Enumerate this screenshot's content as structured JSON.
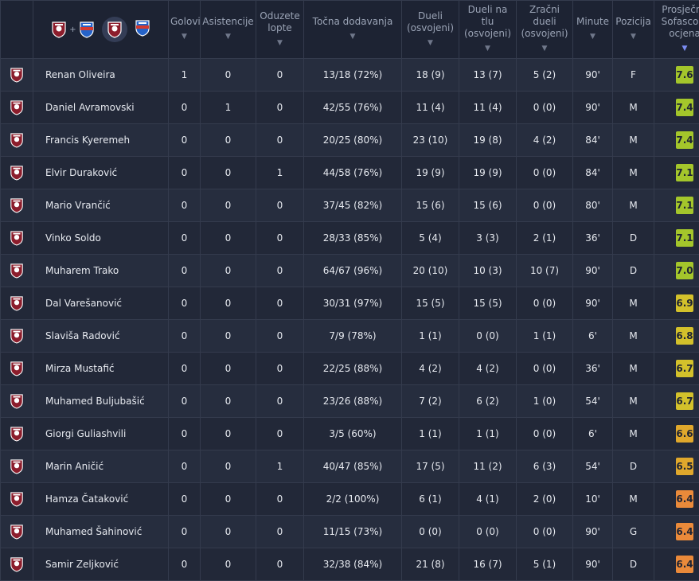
{
  "icons": {
    "team_crest": "club-crest-icon",
    "opponent_crest": "opponent-crest-icon",
    "sort_arrow": "sort-arrow-icon"
  },
  "filter": {
    "plus": "+"
  },
  "columns": [
    {
      "label": "Golovi",
      "arrow": "▼"
    },
    {
      "label": "Asistencije",
      "arrow": "▼"
    },
    {
      "label": "Oduzete lopte",
      "arrow": "▼"
    },
    {
      "label": "Točna dodavanja",
      "arrow": "▼"
    },
    {
      "label": "Dueli (osvojeni)",
      "arrow": "▼"
    },
    {
      "label": "Dueli na tlu (osvojeni)",
      "arrow": "▼"
    },
    {
      "label": "Zračni dueli (osvojeni)",
      "arrow": "▼"
    },
    {
      "label": "Minute",
      "arrow": "▼"
    },
    {
      "label": "Pozicija",
      "arrow": "▼"
    },
    {
      "label": "Prosječna Sofascore ocjena",
      "arrow": "▼"
    }
  ],
  "colors": {
    "rating_high": "#a4c62b",
    "rating_mid_high": "#d3c12b",
    "rating_mid": "#e0a82c",
    "rating_low": "#ea8a3a",
    "crest_red": "#8c1d2c",
    "opponent_blue": "#2563c9",
    "opponent_red": "#d43a30"
  },
  "players": [
    {
      "name": "Renan Oliveira",
      "goals": "1",
      "assists": "0",
      "tackles": "0",
      "passes": "13/18 (72%)",
      "duels": "18 (9)",
      "ground": "13 (7)",
      "aerial": "5 (2)",
      "minutes": "90'",
      "pos": "F",
      "rating": "7.6",
      "tier": "high"
    },
    {
      "name": "Daniel Avramovski",
      "goals": "0",
      "assists": "1",
      "tackles": "0",
      "passes": "42/55 (76%)",
      "duels": "11 (4)",
      "ground": "11 (4)",
      "aerial": "0 (0)",
      "minutes": "90'",
      "pos": "M",
      "rating": "7.4",
      "tier": "high"
    },
    {
      "name": "Francis Kyeremeh",
      "goals": "0",
      "assists": "0",
      "tackles": "0",
      "passes": "20/25 (80%)",
      "duels": "23 (10)",
      "ground": "19 (8)",
      "aerial": "4 (2)",
      "minutes": "84'",
      "pos": "M",
      "rating": "7.4",
      "tier": "high"
    },
    {
      "name": "Elvir Duraković",
      "goals": "0",
      "assists": "0",
      "tackles": "1",
      "passes": "44/58 (76%)",
      "duels": "19 (9)",
      "ground": "19 (9)",
      "aerial": "0 (0)",
      "minutes": "84'",
      "pos": "M",
      "rating": "7.1",
      "tier": "high"
    },
    {
      "name": "Mario Vrančić",
      "goals": "0",
      "assists": "0",
      "tackles": "0",
      "passes": "37/45 (82%)",
      "duels": "15 (6)",
      "ground": "15 (6)",
      "aerial": "0 (0)",
      "minutes": "80'",
      "pos": "M",
      "rating": "7.1",
      "tier": "high"
    },
    {
      "name": "Vinko Soldo",
      "goals": "0",
      "assists": "0",
      "tackles": "0",
      "passes": "28/33 (85%)",
      "duels": "5 (4)",
      "ground": "3 (3)",
      "aerial": "2 (1)",
      "minutes": "36'",
      "pos": "D",
      "rating": "7.1",
      "tier": "high"
    },
    {
      "name": "Muharem Trako",
      "goals": "0",
      "assists": "0",
      "tackles": "0",
      "passes": "64/67 (96%)",
      "duels": "20 (10)",
      "ground": "10 (3)",
      "aerial": "10 (7)",
      "minutes": "90'",
      "pos": "D",
      "rating": "7.0",
      "tier": "high"
    },
    {
      "name": "Dal Varešanović",
      "goals": "0",
      "assists": "0",
      "tackles": "0",
      "passes": "30/31 (97%)",
      "duels": "15 (5)",
      "ground": "15 (5)",
      "aerial": "0 (0)",
      "minutes": "90'",
      "pos": "M",
      "rating": "6.9",
      "tier": "mid_high"
    },
    {
      "name": "Slaviša Radović",
      "goals": "0",
      "assists": "0",
      "tackles": "0",
      "passes": "7/9 (78%)",
      "duels": "1 (1)",
      "ground": "0 (0)",
      "aerial": "1 (1)",
      "minutes": "6'",
      "pos": "M",
      "rating": "6.8",
      "tier": "mid_high"
    },
    {
      "name": "Mirza Mustafić",
      "goals": "0",
      "assists": "0",
      "tackles": "0",
      "passes": "22/25 (88%)",
      "duels": "4 (2)",
      "ground": "4 (2)",
      "aerial": "0 (0)",
      "minutes": "36'",
      "pos": "M",
      "rating": "6.7",
      "tier": "mid_high"
    },
    {
      "name": "Muhamed Buljubašić",
      "goals": "0",
      "assists": "0",
      "tackles": "0",
      "passes": "23/26 (88%)",
      "duels": "7 (2)",
      "ground": "6 (2)",
      "aerial": "1 (0)",
      "minutes": "54'",
      "pos": "M",
      "rating": "6.7",
      "tier": "mid_high"
    },
    {
      "name": "Giorgi Guliashvili",
      "goals": "0",
      "assists": "0",
      "tackles": "0",
      "passes": "3/5 (60%)",
      "duels": "1 (1)",
      "ground": "1 (1)",
      "aerial": "0 (0)",
      "minutes": "6'",
      "pos": "M",
      "rating": "6.6",
      "tier": "mid"
    },
    {
      "name": "Marin Aničić",
      "goals": "0",
      "assists": "0",
      "tackles": "1",
      "passes": "40/47 (85%)",
      "duels": "17 (5)",
      "ground": "11 (2)",
      "aerial": "6 (3)",
      "minutes": "54'",
      "pos": "D",
      "rating": "6.5",
      "tier": "mid"
    },
    {
      "name": "Hamza Čataković",
      "goals": "0",
      "assists": "0",
      "tackles": "0",
      "passes": "2/2 (100%)",
      "duels": "6 (1)",
      "ground": "4 (1)",
      "aerial": "2 (0)",
      "minutes": "10'",
      "pos": "M",
      "rating": "6.4",
      "tier": "low"
    },
    {
      "name": "Muhamed Šahinović",
      "goals": "0",
      "assists": "0",
      "tackles": "0",
      "passes": "11/15 (73%)",
      "duels": "0 (0)",
      "ground": "0 (0)",
      "aerial": "0 (0)",
      "minutes": "90'",
      "pos": "G",
      "rating": "6.4",
      "tier": "low"
    },
    {
      "name": "Samir Zeljković",
      "goals": "0",
      "assists": "0",
      "tackles": "0",
      "passes": "32/38 (84%)",
      "duels": "21 (8)",
      "ground": "16 (7)",
      "aerial": "5 (1)",
      "minutes": "90'",
      "pos": "D",
      "rating": "6.4",
      "tier": "low"
    }
  ]
}
